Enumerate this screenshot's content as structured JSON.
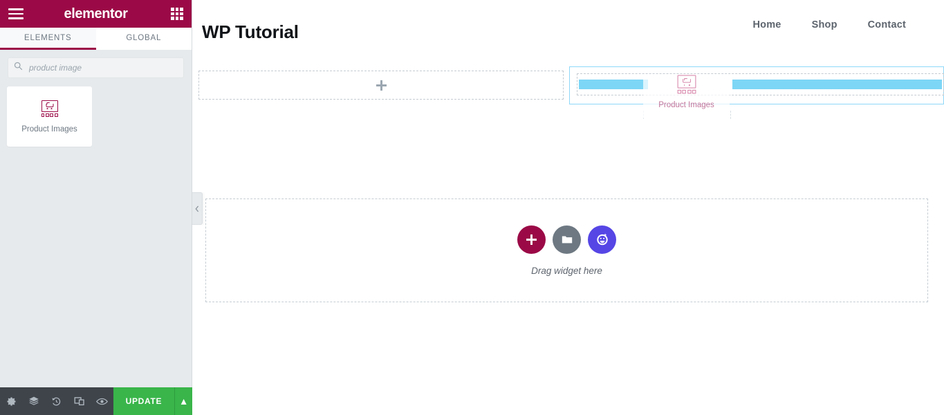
{
  "panel": {
    "header": {
      "menu_icon": "hamburger-icon",
      "logo": "elementor",
      "apps_icon": "grid-apps-icon"
    },
    "tabs": [
      {
        "label": "ELEMENTS",
        "active": true
      },
      {
        "label": "GLOBAL",
        "active": false
      }
    ],
    "search": {
      "icon": "search-icon",
      "value": "",
      "placeholder": "product image"
    },
    "results": [
      {
        "label": "Product Images",
        "icon": "product-images-icon"
      }
    ],
    "collapse_handle_icon": "chevron-left-icon",
    "footer": {
      "icons": [
        {
          "name": "settings-gear-icon",
          "glyph": "⚙"
        },
        {
          "name": "navigator-layers-icon",
          "glyph": "≣"
        },
        {
          "name": "history-icon",
          "glyph": "↺"
        },
        {
          "name": "responsive-mode-icon",
          "glyph": "❐"
        },
        {
          "name": "preview-eye-icon",
          "glyph": "◉"
        }
      ],
      "update_label": "UPDATE",
      "update_caret": "▴",
      "update_color": "#39b54a"
    }
  },
  "canvas": {
    "site_title": "WP Tutorial",
    "nav": [
      {
        "label": "Home"
      },
      {
        "label": "Shop"
      },
      {
        "label": "Contact"
      }
    ],
    "row_top": {
      "left_column": {
        "add_icon": "plus-icon"
      },
      "right_column": {
        "state": "drop-target-highlighted",
        "highlight_color": "#8ed8f8",
        "placeholder_bar_color": "#7dd6f6"
      }
    },
    "drag_ghost": {
      "label": "Product Images",
      "icon": "product-images-icon"
    },
    "row_bottom": {
      "buttons": [
        {
          "name": "add-new-section-button",
          "icon": "plus-icon",
          "color": "#9b0a46"
        },
        {
          "name": "add-template-button",
          "icon": "folder-icon",
          "color": "#6d7882"
        },
        {
          "name": "elementor-ai-button",
          "icon": "ai-face-icon",
          "color": "#5646e5"
        }
      ],
      "hint": "Drag widget here"
    }
  },
  "colors": {
    "brand": "#9b0a46",
    "panel_bg": "#e6eaec",
    "footer_bg": "#3f444b",
    "update_green": "#39b54a",
    "drop_blue": "#7dd6f6",
    "dash_gray": "#c5ccd2"
  }
}
